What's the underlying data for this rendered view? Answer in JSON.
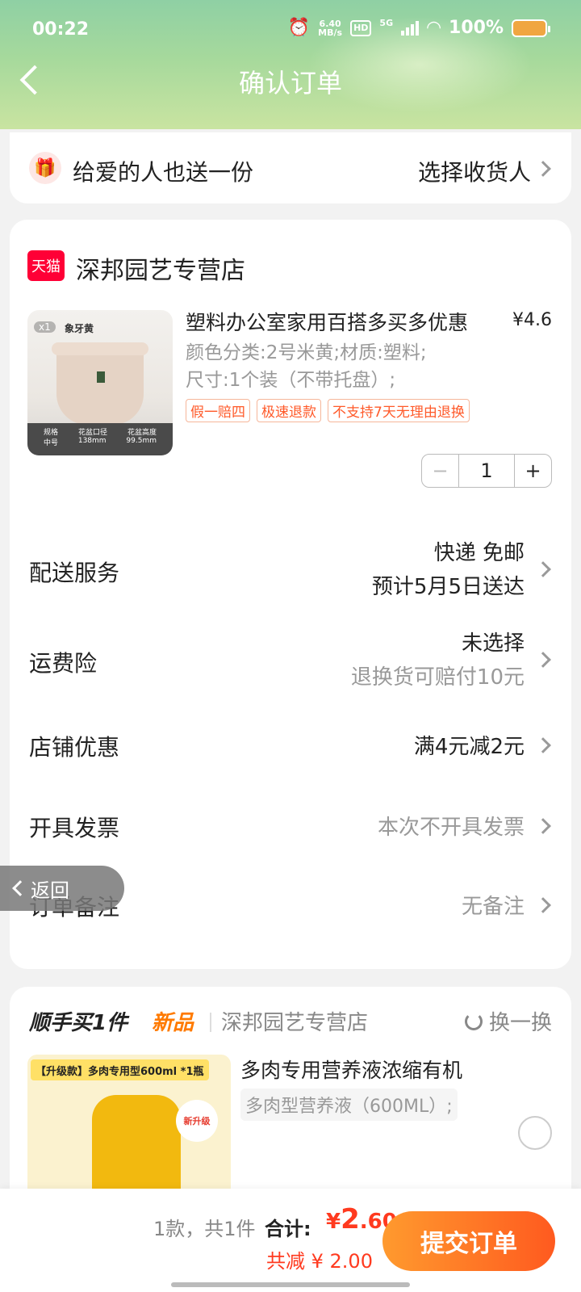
{
  "status_bar": {
    "time": "00:22",
    "speed": "6.40\nMB/s",
    "hd": "HD",
    "network": "5G",
    "battery": "100%"
  },
  "nav": {
    "title": "确认订单"
  },
  "gift": {
    "label": "给爱的人也送一份",
    "action": "选择收货人"
  },
  "shop": {
    "badge": "天猫",
    "name": "深邦园艺专营店"
  },
  "product": {
    "image_tag": "象牙黄",
    "qty_badge": "x1",
    "spec_headers": [
      "规格",
      "花盆口径",
      "花盆高度"
    ],
    "spec_values": [
      "中号",
      "138mm",
      "99.5mm"
    ],
    "title": "塑料办公室家用百搭多买多优惠",
    "price": "¥4.6",
    "sku_line1": "颜色分类:2号米黄;材质:塑料;",
    "sku_line2": "尺寸:1个装（不带托盘）;",
    "tags": [
      "假一赔四",
      "极速退款",
      "不支持7天无理由退换"
    ],
    "quantity": "1",
    "minus": "−",
    "plus": "+"
  },
  "rows": {
    "delivery": {
      "label": "配送服务",
      "value": "快递 免邮",
      "sub": "预计5月5日送达"
    },
    "insurance": {
      "label": "运费险",
      "value": "未选择",
      "sub": "退换货可赔付10元"
    },
    "discount": {
      "label": "店铺优惠",
      "value": "满4元减2元"
    },
    "invoice": {
      "label": "开具发票",
      "value": "本次不开具发票"
    },
    "remark": {
      "label": "订单备注",
      "value": "无备注"
    }
  },
  "back_float": {
    "label": "返回"
  },
  "recommend": {
    "title": "顺手买1件",
    "new": "新品",
    "shop": "深邦园艺专营店",
    "swap": "换一换",
    "banner": "【升级款】多肉专用型600ml *1瓶",
    "new_upgrade": "新升级",
    "name": "多肉专用营养液浓缩有机",
    "spec": "多肉型营养液（600ML）;"
  },
  "bottom": {
    "count": "1款，共1件",
    "total_label": "合计:",
    "total_symbol": "¥",
    "total_int": "2",
    "total_dec": ".60",
    "saved": "共减 ¥ 2.00",
    "submit": "提交订单"
  },
  "colors": {
    "accent_red": "#ff3a1f",
    "tmall_red": "#ff0036",
    "submit_gradient_start": "#ff9a2e",
    "submit_gradient_end": "#ff5a1f"
  }
}
